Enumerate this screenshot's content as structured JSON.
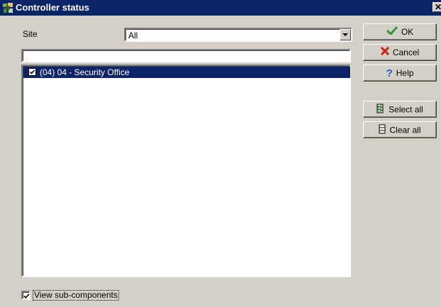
{
  "window": {
    "title": "Controller status"
  },
  "icons": {
    "app": "controller-app-icon",
    "close": "close-icon"
  },
  "site": {
    "label": "Site",
    "value": "All"
  },
  "filter": {
    "value": ""
  },
  "list": {
    "items": [
      {
        "label": "(04) 04 - Security Office",
        "checked": true
      }
    ]
  },
  "buttons": {
    "ok": "OK",
    "cancel": "Cancel",
    "help": "Help",
    "select_all": "Select all",
    "clear_all": "Clear all"
  },
  "options": {
    "view_sub_components": {
      "label": "View sub-components",
      "checked": true
    }
  },
  "colors": {
    "titlebar": "#0a246a",
    "selection": "#0a246a",
    "window_bg": "#d4d0c8"
  }
}
